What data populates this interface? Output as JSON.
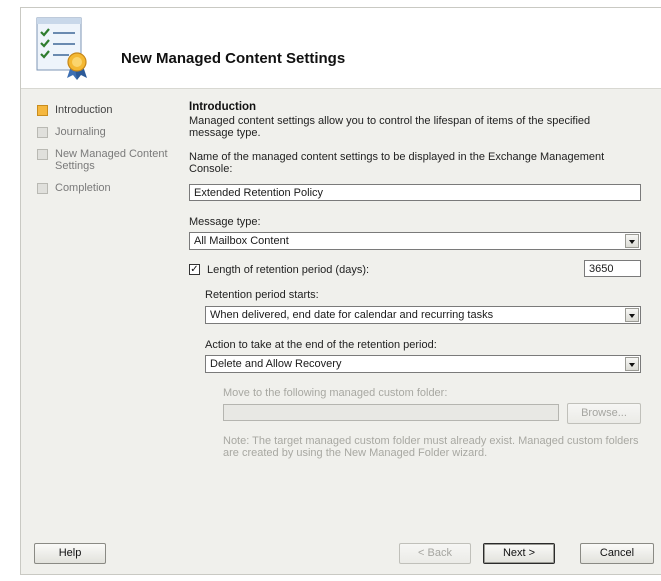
{
  "header": {
    "title": "New Managed Content Settings",
    "icon": "checklist-certificate-icon"
  },
  "nav": {
    "items": [
      {
        "label": "Introduction",
        "state": "current"
      },
      {
        "label": "Journaling",
        "state": "pending"
      },
      {
        "label": "New Managed Content Settings",
        "state": "pending"
      },
      {
        "label": "Completion",
        "state": "pending"
      }
    ]
  },
  "intro": {
    "title": "Introduction",
    "description": "Managed content settings allow you to control the lifespan of items of the specified message type.",
    "name_label": "Name of the managed content settings to be displayed in the Exchange Management Console:",
    "name_value": "Extended Retention Policy",
    "message_type_label": "Message type:",
    "message_type_value": "All Mailbox Content",
    "retention_checkbox_label": "Length of retention period (days):",
    "retention_checked": true,
    "retention_days": "3650",
    "retention_starts_label": "Retention period starts:",
    "retention_starts_value": "When delivered, end date for calendar and recurring tasks",
    "action_label": "Action to take at the end of the retention period:",
    "action_value": "Delete and Allow Recovery",
    "move_folder_label": "Move to the following managed custom folder:",
    "move_folder_value": "",
    "browse_label": "Browse...",
    "note": "Note: The target managed custom folder must already exist. Managed custom folders are created by using the New Managed Folder wizard."
  },
  "footer": {
    "help_label": "Help",
    "back_label": "< Back",
    "next_label": "Next >",
    "cancel_label": "Cancel"
  }
}
